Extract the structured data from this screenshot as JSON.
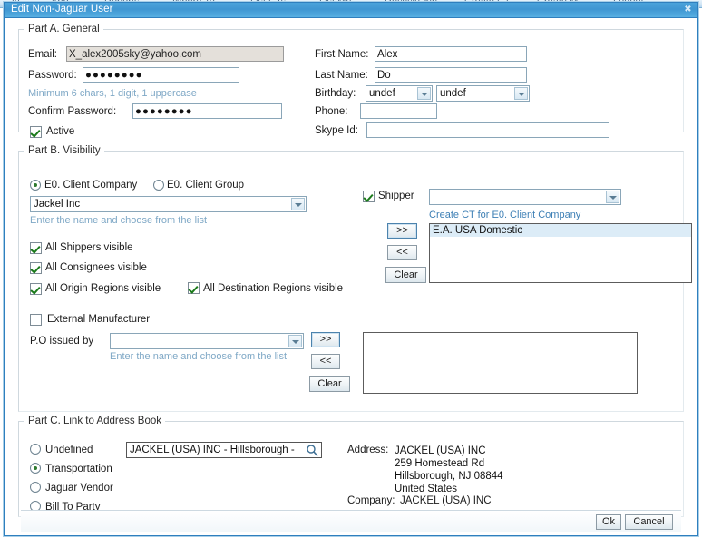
{
  "background_menu": [
    "...in",
    "App...",
    "Reports",
    "Where To",
    "List CTs",
    "List Me...",
    "Recycle Bin",
    "Create CT",
    "Create M...",
    "Logout"
  ],
  "window": {
    "title": "Edit Non-Jaguar User",
    "close_icon": "close-icon",
    "close_glyph": "✖"
  },
  "part_a": {
    "legend": "Part A. General",
    "email_label": "Email:",
    "email_value": "X_alex2005sky@yahoo.com",
    "password_label": "Password:",
    "password_value": "●●●●●●●●",
    "password_hint": "Minimum 6 chars, 1 digit, 1 uppercase",
    "confirm_label": "Confirm Password:",
    "confirm_value": "●●●●●●●●",
    "active_label": "Active",
    "active_checked": true,
    "first_name_label": "First Name:",
    "first_name_value": "Alex",
    "last_name_label": "Last Name:",
    "last_name_value": "Do",
    "birthday_label": "Birthday:",
    "birthday_month": "undef",
    "birthday_day": "undef",
    "phone_label": "Phone:",
    "phone_value": "",
    "skype_label": "Skype Id:",
    "skype_value": ""
  },
  "part_b": {
    "legend": "Part B. Visibility",
    "radio_client_company": "E0. Client Company",
    "radio_client_group": "E0. Client Group",
    "selected_radio": "client_company",
    "company_value": "Jackel Inc",
    "company_hint": "Enter the name and choose from the list",
    "chk_all_shippers": "All Shippers visible",
    "chk_all_shippers_checked": true,
    "chk_all_consignees": "All Consignees visible",
    "chk_all_consignees_checked": true,
    "chk_all_origin": "All Origin Regions visible",
    "chk_all_origin_checked": true,
    "chk_all_destination": "All Destination Regions visible",
    "chk_all_destination_checked": true,
    "chk_external_manufacturer": "External Manufacturer",
    "chk_external_manufacturer_checked": false,
    "shipper_label": "Shipper",
    "shipper_checked": true,
    "shipper_combo_value": "",
    "create_ct_link": "Create CT for E0. Client Company",
    "ct_add_button": ">>",
    "ct_remove_button": "<<",
    "ct_clear_button": "Clear",
    "ct_list": [
      "E.A. USA Domestic"
    ],
    "ct_list_selected": 0,
    "po_label": "P.O issued by",
    "po_combo_value": "",
    "po_hint": "Enter the name and choose from the list",
    "po_add_button": ">>",
    "po_remove_button": "<<",
    "po_clear_button": "Clear",
    "po_list": []
  },
  "part_c": {
    "legend": "Part C. Link to Address Book",
    "radio_undefined": "Undefined",
    "radio_transportation": "Transportation",
    "radio_jaguar_vendor": "Jaguar Vendor",
    "radio_bill_to_party": "Bill To Party",
    "selected_radio": "transportation",
    "lookup_value": "JACKEL (USA) INC - Hillsborough -",
    "lookup_icon": "magnifier-icon",
    "address_label": "Address:",
    "address_lines": "JACKEL (USA) INC\n259 Homestead Rd\nHillsborough, NJ 08844\nUnited States",
    "company_label": "Company:",
    "company_value": "JACKEL (USA) INC"
  },
  "footer": {
    "ok_label": "Ok",
    "cancel_label": "Cancel"
  },
  "colors": {
    "titlebar": "#3f96d2",
    "accent": "#2f7fbe",
    "hint": "#7fa8c6",
    "link": "#3d7fb5",
    "check": "#1a7a1a",
    "list_selected": "#dcecf7"
  }
}
